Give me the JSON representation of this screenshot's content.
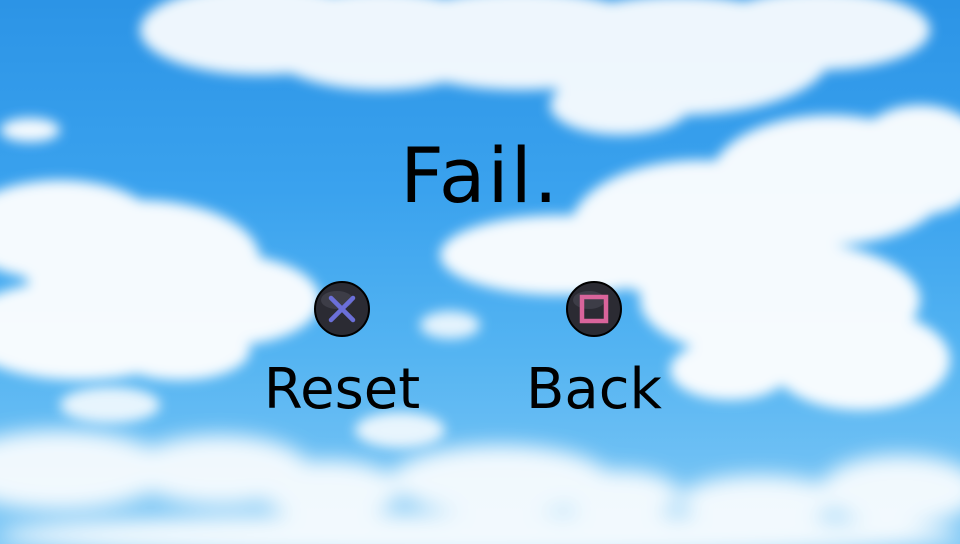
{
  "screen": {
    "title": "Fail."
  },
  "actions": [
    {
      "id": "reset",
      "label": "Reset",
      "icon": "cross-button-icon",
      "icon_color": "#6b6fd8"
    },
    {
      "id": "back",
      "label": "Back",
      "icon": "square-button-icon",
      "icon_color": "#d9649b"
    }
  ],
  "colors": {
    "sky_top": "#2c94e6",
    "sky_bottom": "#82c9f5",
    "cloud": "#ffffff",
    "button_body": "#2b2b33",
    "text": "#000000"
  }
}
